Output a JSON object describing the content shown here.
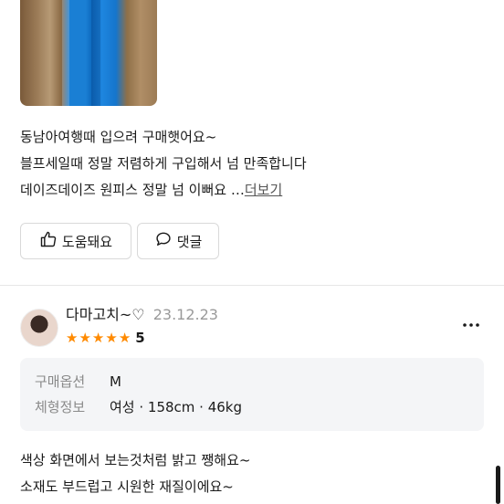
{
  "review1": {
    "lines": [
      "동남아여행때 입으려 구매햇어요~",
      "블프세일때 정말 저렴하게 구입해서 넘 만족합니다",
      "데이즈데이즈 원피스 정말 넘 이뻐요 …"
    ],
    "more_label": "더보기",
    "helpful_label": "도움돼요",
    "comment_label": "댓글"
  },
  "review2": {
    "username": "다마고치~♡",
    "date": "23.12.23",
    "rating": 5,
    "rating_text": "5",
    "option_key": "구매옵션",
    "option_value": "M",
    "body_key": "체형정보",
    "body_value": "여성 · 158cm · 46kg",
    "lines": [
      "색상 화면에서 보는것처럼 밝고 쨍해요~",
      "소재도 부드럽고 시원한 재질이에요~"
    ]
  },
  "colors": {
    "star": "#ff8a00",
    "text": "#1a1a1a",
    "muted": "#8a8a8a",
    "box": "#f4f5f7"
  },
  "icons": [
    "thumbs-up-icon",
    "comment-icon",
    "more-icon",
    "star-icon"
  ]
}
